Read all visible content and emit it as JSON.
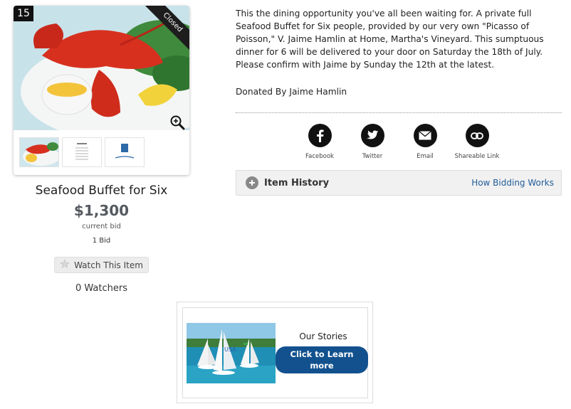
{
  "item": {
    "lot_number": "15",
    "status_ribbon": "Closed",
    "title": "Seafood Buffet for Six",
    "price": "$1,300",
    "price_caption": "current bid",
    "bid_count": "1 Bid",
    "watch_button_label": "Watch This Item",
    "watchers": "0 Watchers",
    "thumbnails": [
      "lobster-dinner-thumb",
      "menu-card-thumb",
      "logo-card-thumb"
    ]
  },
  "details": {
    "description": "This the dining opportunity you've all been waiting for. A private full Seafood Buffet for Six people, provided by our very own \"Picasso of Poisson,\" V. Jaime Hamlin at Home, Martha's Vineyard. This sumptuous dinner for 6 will be delivered to your door on Saturday the 18th of July. Please confirm with Jaime by Sunday the 12th at the latest.",
    "donated_by": "Donated By Jaime Hamlin"
  },
  "share": {
    "items": [
      {
        "label": "Facebook",
        "icon": "facebook-icon"
      },
      {
        "label": "Twitter",
        "icon": "twitter-icon"
      },
      {
        "label": "Email",
        "icon": "envelope-icon"
      },
      {
        "label": "Shareable Link",
        "icon": "link-icon"
      }
    ]
  },
  "history": {
    "label": "Item History",
    "link": "How Bidding Works"
  },
  "promo": {
    "title": "Our Stories",
    "button_label": "Click to Learn more"
  },
  "colors": {
    "accent_blue": "#12518e",
    "link_blue": "#1f5c99",
    "price_grey": "#555a60"
  }
}
